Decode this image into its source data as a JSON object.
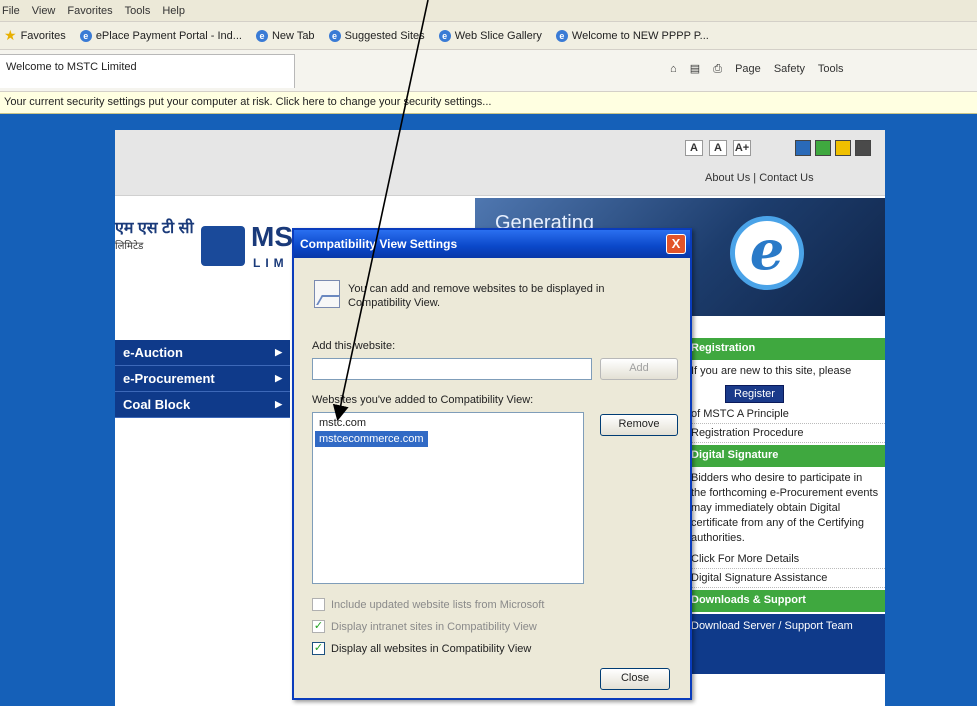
{
  "browser": {
    "menu": [
      "File",
      "View",
      "Favorites",
      "Tools",
      "Help"
    ],
    "favorites_label": "Favorites",
    "favorites_items": [
      "ePlace Payment Portal - Ind...",
      "New Tab",
      "Suggested Sites",
      "Web Slice Gallery",
      "Welcome to NEW PPPP P..."
    ],
    "tab_title": "Welcome to MSTC Limited",
    "toolbar_items": [
      "Page",
      "Safety",
      "Tools"
    ],
    "infobar_text": "Your current security settings put your computer at risk. Click here to change your security settings..."
  },
  "site": {
    "font_sizes": [
      "A",
      "A",
      "A+"
    ],
    "theme_colors": [
      "#2a6ab8",
      "#3fa83f",
      "#f0c000",
      "#4a4a4a"
    ],
    "top_links": "About Us | Contact Us",
    "logo_hindi": "एम एस टी सी",
    "logo_hindi_sub": "लिमिटेड",
    "logo_text": "MS",
    "logo_sub": "LIM",
    "banner_text": "Generating",
    "banner_logo": "e",
    "nav": [
      "e-Auction",
      "e-Procurement",
      "Coal Block"
    ],
    "right": {
      "registration_head": "Registration",
      "registration_text": "If you are new to this site, please",
      "register_button": "Register",
      "links": [
        "of MSTC A Principle",
        "Registration Procedure"
      ],
      "signature_head": "Digital Signature",
      "signature_text": "Bidders who desire to participate in the forthcoming e-Procurement events may immediately obtain Digital certificate from any of the Certifying authorities.",
      "more_link": "Click For More Details",
      "assist_link": "Digital Signature Assistance",
      "support_head": "Downloads & Support",
      "support_text": "Download Server / Support Team"
    }
  },
  "dialog": {
    "title": "Compatibility View Settings",
    "close": "X",
    "description": "You can add and remove websites to be displayed in Compatibility View.",
    "add_label": "Add this website:",
    "add_value": "",
    "add_button": "Add",
    "list_label": "Websites you've added to Compatibility View:",
    "list_items": [
      "mstc.com",
      "mstcecommerce.com"
    ],
    "remove_button": "Remove",
    "checkboxes": [
      {
        "label": "Include updated website lists from Microsoft",
        "checked": false,
        "dim": true
      },
      {
        "label": "Display intranet sites in Compatibility View",
        "checked": true,
        "dim": true
      },
      {
        "label": "Display all websites in Compatibility View",
        "checked": true,
        "dim": false
      }
    ],
    "close_button": "Close"
  }
}
